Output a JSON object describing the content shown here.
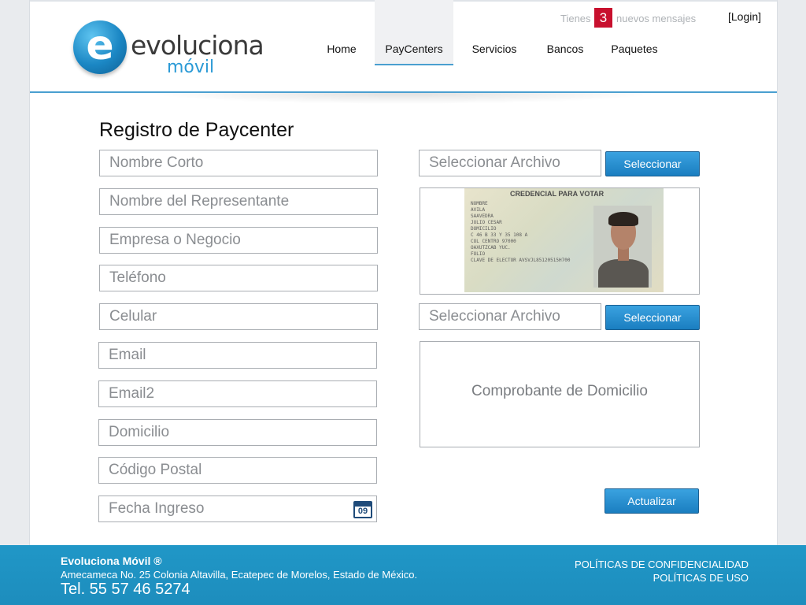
{
  "brand": {
    "logo_letter": "e",
    "logo_word": "evoluciona",
    "logo_sub": "móvil"
  },
  "nav": {
    "items": [
      {
        "label": "Home"
      },
      {
        "label": "PayCenters"
      },
      {
        "label": "Servicios"
      },
      {
        "label": "Bancos"
      },
      {
        "label": "Paquetes"
      }
    ],
    "active": "PayCenters"
  },
  "messages": {
    "prefix": "Tienes",
    "count": "3",
    "suffix": "nuevos mensajes"
  },
  "login_label": "[Login]",
  "form": {
    "title": "Registro de Paycenter",
    "fields": {
      "nombre_corto": "Nombre Corto",
      "nombre_representante": "Nombre del Representante",
      "empresa": "Empresa o Negocio",
      "telefono": "Teléfono",
      "celular": "Celular",
      "email": "Email",
      "email2": "Email2",
      "domicilio": "Domicilio",
      "codigo_postal": "Código Postal",
      "fecha_ingreso": "Fecha Ingreso"
    },
    "file_placeholder": "Seleccionar Archivo",
    "select_button": "Seleccionar",
    "doc_placeholder": "Comprobante de Domicilio",
    "submit_button": "Actualizar",
    "calendar_day": "09"
  },
  "id_card": {
    "header": "CREDENCIAL PARA VOTAR",
    "lines": [
      "NOMBRE",
      "AVILA",
      "SAAVEDRA",
      "JULIO CESAR",
      "DOMICILIO",
      "C 46 B 33 Y 35 108 A",
      "COL CENTRO 97000",
      "OAXUTZCAB YUC.",
      "FOLIO",
      "CLAVE DE ELECTOR AVSVJL85120515H700"
    ]
  },
  "footer": {
    "company": "Evoluciona Móvil ®",
    "address": "Amecameca No. 25 Colonia Altavilla, Ecatepec de Morelos, Estado de México.",
    "tel": "Tel. 55 57 46 5274",
    "link_privacy": "POLÍTICAS DE CONFIDENCIALIDAD",
    "link_terms": "POLÍTICAS DE USO"
  },
  "colors": {
    "accent": "#1a7ec0",
    "badge": "#c8102e",
    "footer": "#2097c7"
  }
}
